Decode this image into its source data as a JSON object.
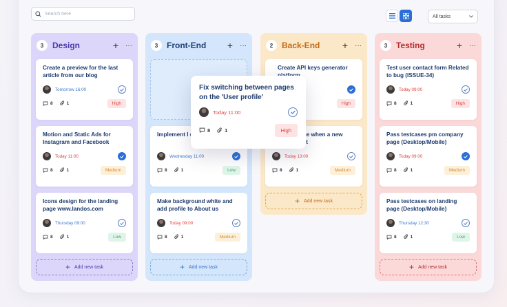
{
  "search": {
    "placeholder": "Search here"
  },
  "toolbar": {
    "filter_value": "All tasks"
  },
  "colors": {
    "accent": "#2b6fd6",
    "design": "#ddd6fb",
    "front_end": "#d3e6fb",
    "back_end": "#fbe8c8",
    "testing": "#fbd9d9"
  },
  "columns": [
    {
      "title": "Design",
      "count": "3",
      "add_label": "Add new task",
      "cards": [
        {
          "title": "Create a preview for the last article from our blog",
          "date": "Tomorrow 16:00",
          "comments": "8",
          "attachments": "1",
          "priority": "High",
          "done": false
        },
        {
          "title": "Motion and Static Ads for Instagram and Facebook",
          "date": "Today 11:00",
          "comments": "8",
          "attachments": "1",
          "priority": "Medium",
          "done": true
        },
        {
          "title": "Icons design for the landing page www.landos.com",
          "date": "Thursday 09:00",
          "comments": "8",
          "attachments": "1",
          "priority": "Low",
          "done": false
        }
      ]
    },
    {
      "title": "Front-End",
      "count": "3",
      "add_label": "Add new task",
      "cards": [
        {
          "title": "Implement l design on la",
          "date": "Wednesday 11:00",
          "comments": "8",
          "attachments": "1",
          "priority": "Low",
          "done": true
        },
        {
          "title": "Make background white and add profile to About us",
          "date": "Today 09:00",
          "comments": "8",
          "attachments": "1",
          "priority": "Medium",
          "done": false
        }
      ]
    },
    {
      "title": "Back-End",
      "count": "2",
      "add_label": "Add new task",
      "cards": [
        {
          "title": "Create API keys generator platform",
          "date": "Today",
          "comments": "8",
          "attachments": "1",
          "priority": "High",
          "done": true
        },
        {
          "title": "to the when a new artist",
          "date": "Today 13:00",
          "comments": "8",
          "attachments": "1",
          "priority": "Medium",
          "done": false
        }
      ]
    },
    {
      "title": "Testing",
      "count": "3",
      "add_label": "Add new task",
      "cards": [
        {
          "title": "Test user contact form Related to bug (ISSUE-34)",
          "date": "Today 09:00",
          "comments": "8",
          "attachments": "1",
          "priority": "High",
          "done": false
        },
        {
          "title": "Pass testcases pm company page (Desktop/Mobile)",
          "date": "Today 09:00",
          "comments": "8",
          "attachments": "1",
          "priority": "Medium",
          "done": true
        },
        {
          "title": "Pass testcases on landing page (Desktop/Mobile)",
          "date": "Thursday 12:30",
          "comments": "8",
          "attachments": "1",
          "priority": "Low",
          "done": false
        }
      ]
    }
  ],
  "dragging_card": {
    "title": "Fix switching between pages on the 'User profile'",
    "date": "Today 11:00",
    "comments": "8",
    "attachments": "1",
    "priority": "High",
    "done": false
  }
}
